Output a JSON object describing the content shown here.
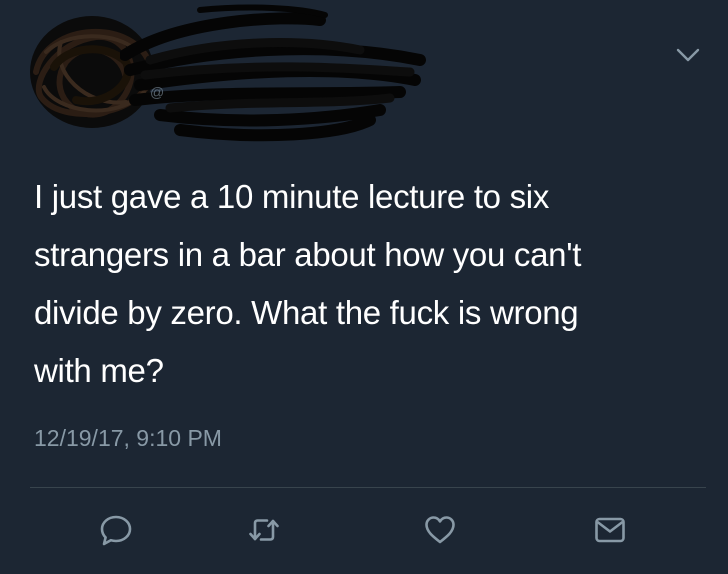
{
  "header": {
    "handle_hint": "@",
    "caret_icon": "chevron-down-icon"
  },
  "tweet": {
    "text_lines": [
      "I just gave a 10 minute lecture to six",
      "strangers in a bar about how you can't",
      "divide by zero. What the fuck is wrong",
      "with me?"
    ],
    "timestamp": "12/19/17, 9:10 PM"
  },
  "actions": {
    "items": [
      {
        "icon": "reply-icon"
      },
      {
        "icon": "retweet-icon"
      },
      {
        "icon": "like-icon"
      },
      {
        "icon": "message-icon"
      }
    ]
  },
  "colors": {
    "background": "#1c2633",
    "text": "#ffffff",
    "secondary": "#8899a6",
    "divider": "#38444d"
  }
}
